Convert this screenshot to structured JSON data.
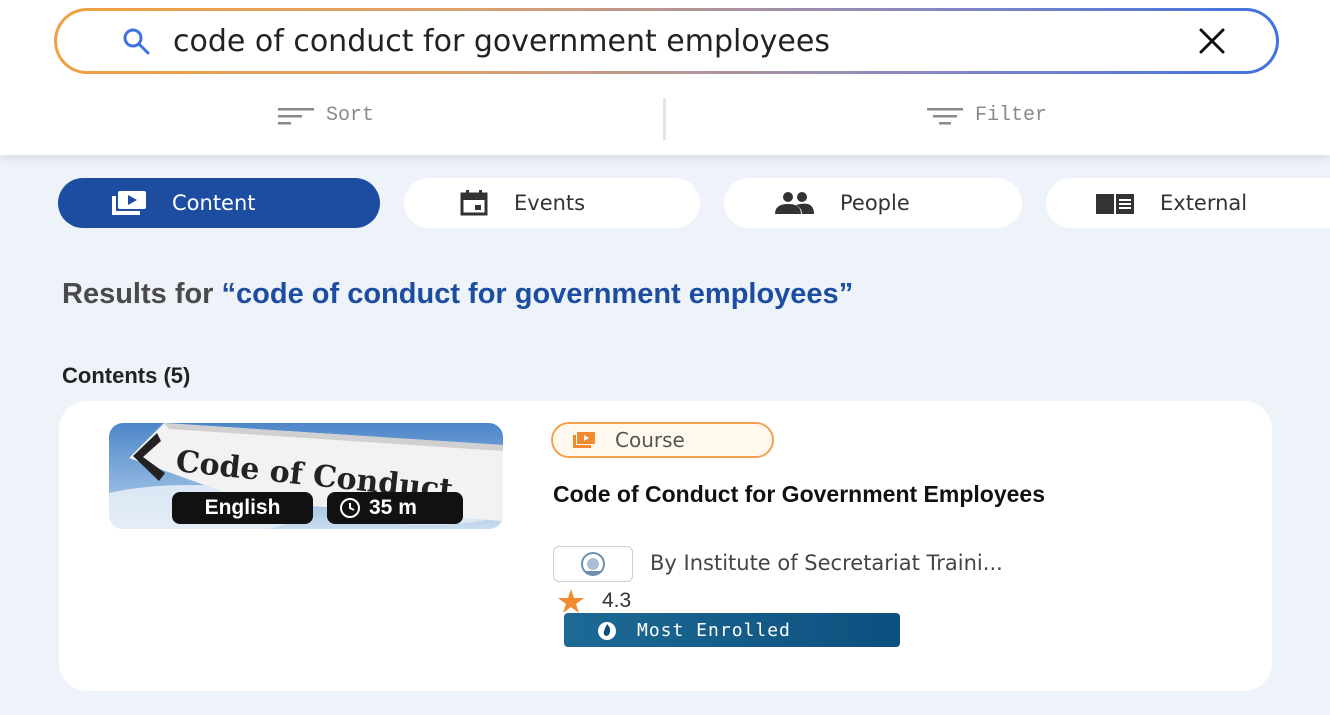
{
  "search": {
    "query": "code of conduct for government employees"
  },
  "toolbar": {
    "sort_label": "Sort",
    "filter_label": "Filter"
  },
  "tabs": [
    {
      "label": "Content",
      "icon": "play-square-icon",
      "active": true
    },
    {
      "label": "Events",
      "icon": "calendar-icon",
      "active": false
    },
    {
      "label": "People",
      "icon": "people-icon",
      "active": false
    },
    {
      "label": "External",
      "icon": "book-icon",
      "active": false
    }
  ],
  "results": {
    "prefix": "Results for ",
    "query_quoted": "“code of conduct for government employees”",
    "contents_count": "Contents (5)"
  },
  "card": {
    "thumbnail_text": "Code of Conduct",
    "language": "English",
    "duration": "35 m",
    "type_badge": "Course",
    "title": "Code of Conduct for Government Employees",
    "provider": "By Institute of Secretariat Traini...",
    "rating": "4.3",
    "tag": "Most Enrolled"
  },
  "colors": {
    "accent": "#1c4da1",
    "page_bg": "#eef2f9",
    "badge_orange": "#f2a24e",
    "star": "#f28a30",
    "enrolled_bg": "#0d4f7e"
  }
}
